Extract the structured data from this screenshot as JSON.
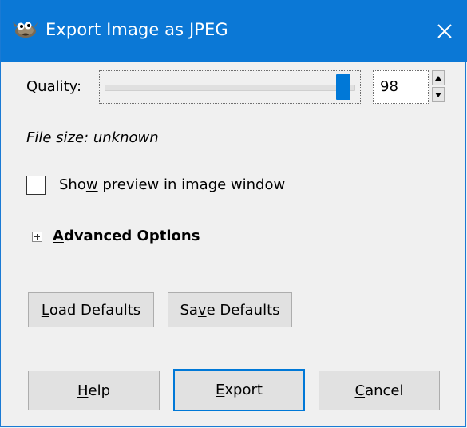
{
  "window": {
    "title": "Export Image as JPEG",
    "app_icon": "gimp-wilber-icon",
    "close_icon": "close-icon",
    "titlebar_color": "#0b78d6"
  },
  "quality": {
    "label_underlined": "Q",
    "label_rest": "uality:",
    "value": "98",
    "slider_fraction": 0.98,
    "accent_color": "#0078d7",
    "spin_up_icon": "chevron-up-icon",
    "spin_down_icon": "chevron-down-icon"
  },
  "file_size": {
    "text": "File size: unknown"
  },
  "preview": {
    "label_before": "Sho",
    "label_underlined": "w",
    "label_after": " preview in image window",
    "checked": false
  },
  "advanced": {
    "expander_icon": "plus-box-icon",
    "label_underlined": "A",
    "label_rest": "dvanced Options"
  },
  "defaults_buttons": {
    "load_underlined": "L",
    "load_rest": "oad Defaults",
    "save_before": "Sa",
    "save_underlined": "v",
    "save_after": "e Defaults"
  },
  "action_buttons": {
    "help_underlined": "H",
    "help_rest": "elp",
    "export_underlined": "E",
    "export_rest": "xport",
    "cancel_underlined": "C",
    "cancel_rest": "ancel"
  }
}
